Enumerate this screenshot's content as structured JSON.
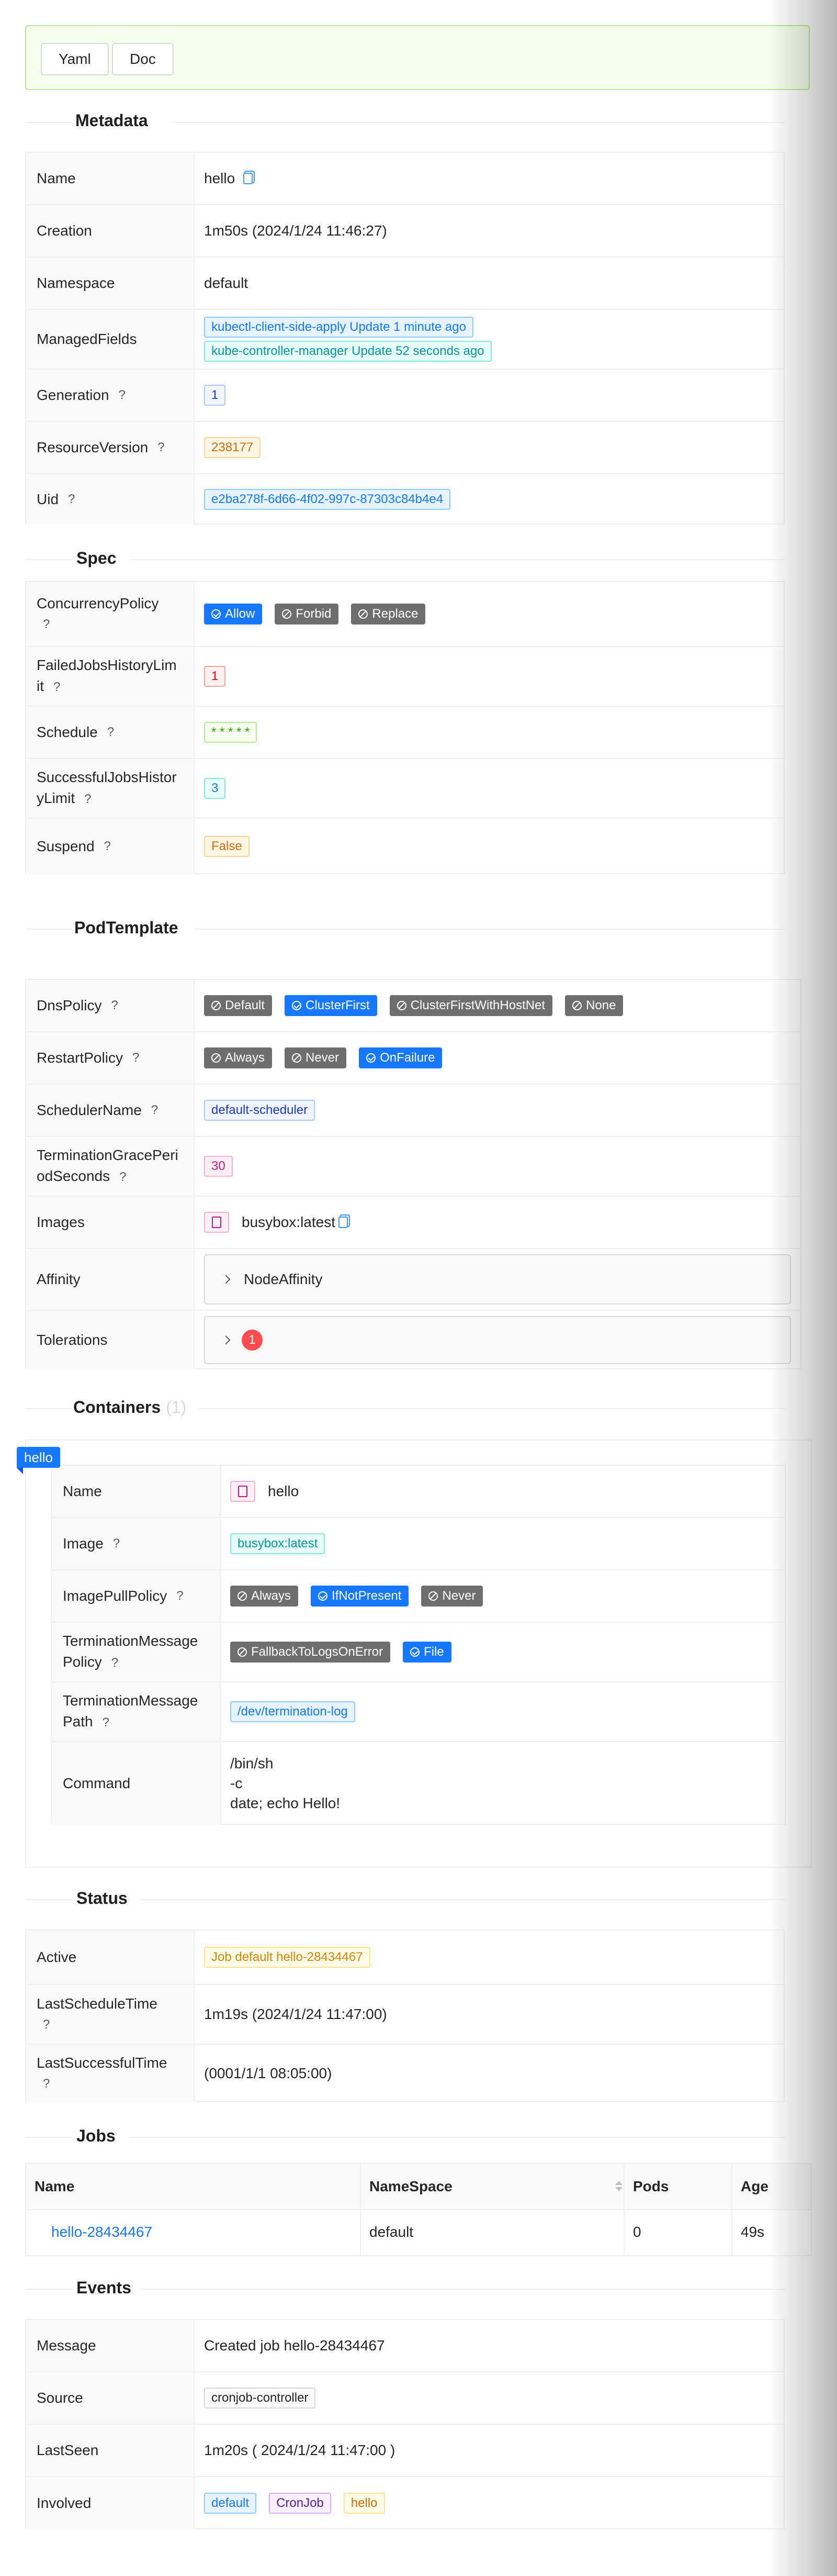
{
  "toolbar": {
    "yaml_label": "Yaml",
    "doc_label": "Doc"
  },
  "metadata": {
    "title": "Metadata",
    "name_label": "Name",
    "name_value": "hello",
    "creation_label": "Creation",
    "creation_value": "1m50s (2024/1/24 11:46:27)",
    "namespace_label": "Namespace",
    "namespace_value": "default",
    "managed_label": "ManagedFields",
    "managed_1": "kubectl-client-side-apply Update 1 minute ago",
    "managed_2": "kube-controller-manager Update 52 seconds ago",
    "generation_label": "Generation",
    "generation_value": "1",
    "rv_label": "ResourceVersion",
    "rv_value": "238177",
    "uid_label": "Uid",
    "uid_value": "e2ba278f-6d66-4f02-997c-87303c84b4e4"
  },
  "help_mark": "?",
  "spec": {
    "title": "Spec",
    "concurrency_label_1": "ConcurrencyPolicy",
    "concurrency_options": [
      "Allow",
      "Forbid",
      "Replace"
    ],
    "failed_label_1": "FailedJobsHistoryLim",
    "failed_label_2": "it",
    "failed_value": "1",
    "schedule_label": "Schedule",
    "schedule_value": "* * * * *",
    "success_label_1": "SuccessfulJobsHistor",
    "success_label_2": "yLimit",
    "success_value": "3",
    "suspend_label": "Suspend",
    "suspend_value": "False"
  },
  "pod_template": {
    "title": "PodTemplate",
    "dns_label": "DnsPolicy",
    "dns_options": [
      "Default",
      "ClusterFirst",
      "ClusterFirstWithHostNet",
      "None"
    ],
    "restart_label": "RestartPolicy",
    "restart_options": [
      "Always",
      "Never",
      "OnFailure"
    ],
    "scheduler_label": "SchedulerName",
    "scheduler_value": "default-scheduler",
    "grace_label_1": "TerminationGracePeri",
    "grace_label_2": "odSeconds",
    "grace_value": "30",
    "images_label": "Images",
    "images_value": "busybox:latest",
    "affinity_label": "Affinity",
    "affinity_value": "NodeAffinity",
    "tolerations_label": "Tolerations",
    "tolerations_count": "1"
  },
  "containers": {
    "title": "Containers",
    "count": "(1)",
    "ribbon": "hello",
    "name_label": "Name",
    "name_value": "hello",
    "image_label": "Image",
    "image_value": "busybox:latest",
    "pull_label": "ImagePullPolicy",
    "pull_options": [
      "Always",
      "IfNotPresent",
      "Never"
    ],
    "tmp_label_1": "TerminationMessage",
    "tmp_label_2": "Policy",
    "tmp_options": [
      "FallbackToLogsOnError",
      "File"
    ],
    "tmpath_label_1": "TerminationMessage",
    "tmpath_label_2": "Path",
    "tmpath_value": "/dev/termination-log",
    "command_label": "Command",
    "command_lines": [
      "/bin/sh",
      "-c",
      "date; echo Hello!"
    ]
  },
  "status": {
    "title": "Status",
    "active_label": "Active",
    "active_value": "Job default hello-28434467",
    "last_schedule_label": "LastScheduleTime",
    "last_schedule_value": "1m19s (2024/1/24 11:47:00)",
    "last_success_label": "LastSuccessfulTime",
    "last_success_value": "(0001/1/1 08:05:00)"
  },
  "jobs": {
    "title": "Jobs",
    "columns": [
      "Name",
      "NameSpace",
      "Pods",
      "Age"
    ],
    "rows": [
      {
        "name": "hello-28434467",
        "namespace": "default",
        "pods": "0",
        "age": "49s"
      }
    ]
  },
  "events": {
    "title": "Events",
    "message_label": "Message",
    "message_value": "Created job hello-28434467",
    "source_label": "Source",
    "source_value": "cronjob-controller",
    "lastseen_label": "LastSeen",
    "lastseen_value": "1m20s ( 2024/1/24 11:47:00 )",
    "involved_label": "Involved",
    "involved_values": [
      "default",
      "CronJob",
      "hello"
    ]
  }
}
